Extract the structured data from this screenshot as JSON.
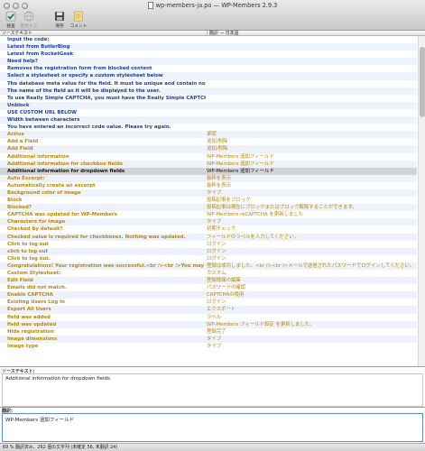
{
  "window": {
    "title": "wp-members-ja.po — WP-Members 2.9.3"
  },
  "toolbar": {
    "validate": "検査",
    "update": "更新する",
    "save": "保存",
    "comment": "コメント"
  },
  "columns": {
    "source": "ソーステキスト",
    "translation": "翻訳 — 日本語"
  },
  "rows": [
    {
      "src": "Input the code:",
      "dst": "",
      "state": "untranslated"
    },
    {
      "src": "Latest from ButlerBlog",
      "dst": "",
      "state": "untranslated"
    },
    {
      "src": "Latest from RocketGeek",
      "dst": "",
      "state": "untranslated"
    },
    {
      "src": "Need help?",
      "dst": "",
      "state": "untranslated"
    },
    {
      "src": "Removes the registration form from blocked content",
      "dst": "",
      "state": "untranslated"
    },
    {
      "src": "Select a stylesheet or specify a custom stylesheet below",
      "dst": "",
      "state": "untranslated"
    },
    {
      "src": "The database meta value for the field. It must be unique and contain no spaces (undersc...",
      "dst": "",
      "state": "untranslated"
    },
    {
      "src": "The name of the field as it will be displayed to the user.",
      "dst": "",
      "state": "untranslated"
    },
    {
      "src": "To use Really Simple CAPTCHA, you must have the Really Simple CAPTCHA plugin install...",
      "dst": "",
      "state": "untranslated"
    },
    {
      "src": "Unblock",
      "dst": "",
      "state": "untranslated"
    },
    {
      "src": "USE CUSTOM URL BELOW",
      "dst": "",
      "state": "untranslated"
    },
    {
      "src": "Width between characters",
      "dst": "",
      "state": "untranslated"
    },
    {
      "src": "You have entered an incorrect code value. Please try again.",
      "dst": "",
      "state": "untranslated"
    },
    {
      "src": "Active",
      "dst": "承認",
      "state": "fuzzy"
    },
    {
      "src": "Add a Field",
      "dst": "追加/削除",
      "state": "fuzzy"
    },
    {
      "src": "Add Field",
      "dst": "追加/削除",
      "state": "fuzzy"
    },
    {
      "src": "Additional information",
      "dst": "WP-Members 追加フィールド",
      "state": "fuzzy"
    },
    {
      "src": "Additional information for checkbox fields",
      "dst": "WP-Members 追加フィールド",
      "state": "fuzzy"
    },
    {
      "src": "Additional information for dropdown fields",
      "dst": "WP-Members 追加フィールド",
      "state": "selected"
    },
    {
      "src": "Auto Excerpt:",
      "dst": "抜粋を表示",
      "state": "fuzzy"
    },
    {
      "src": "Automatically create an excerpt",
      "dst": "抜粋を表示",
      "state": "fuzzy"
    },
    {
      "src": "Background color of image",
      "dst": "タイプ",
      "state": "fuzzy"
    },
    {
      "src": "Block",
      "dst": "投稿記事をブロック",
      "state": "fuzzy"
    },
    {
      "src": "Blocked?",
      "dst": "投稿記事は現在にブロックまたはブロック解除することができます。",
      "state": "fuzzy"
    },
    {
      "src": "CAPTCHA was updated for WP-Members",
      "dst": "WP-Members reCAPTCHA を更新しました",
      "state": "fuzzy"
    },
    {
      "src": "Characters for image",
      "dst": "タイプ",
      "state": "fuzzy"
    },
    {
      "src": "Checked by default?",
      "dst": "初期チェック",
      "state": "fuzzy"
    },
    {
      "src": "Checked value is required for checkboxes. Nothing was updated.",
      "dst": "フィールドのラベルを入力してください。",
      "state": "fuzzy"
    },
    {
      "src": "Click to log out",
      "dst": "ログイン",
      "state": "fuzzy"
    },
    {
      "src": "click to log out",
      "dst": "ログイン",
      "state": "fuzzy"
    },
    {
      "src": "Click to log out.",
      "dst": "ログイン",
      "state": "fuzzy"
    },
    {
      "src": "Congratulations! Your registration was successful.<br /><br />You may now log in usi...",
      "dst": "登録は成功しました。<br /><br />メールで送信されたパスワードでログインしてください。",
      "state": "fuzzy"
    },
    {
      "src": "Custom Stylesheet:",
      "dst": "カスタム",
      "state": "fuzzy"
    },
    {
      "src": "Edit Field",
      "dst": "登録情報の編集",
      "state": "fuzzy"
    },
    {
      "src": "Emails did not match.",
      "dst": "パスワードの確認",
      "state": "fuzzy"
    },
    {
      "src": "Enable CAPTCHA",
      "dst": "CAPTCHAの使用",
      "state": "fuzzy"
    },
    {
      "src": "Existing Users Log In",
      "dst": "ログイン",
      "state": "fuzzy"
    },
    {
      "src": "Export All Users",
      "dst": "エクスポート",
      "state": "fuzzy"
    },
    {
      "src": "field was added",
      "dst": "ラベル",
      "state": "fuzzy"
    },
    {
      "src": "field was updated",
      "dst": "WP-Members フィールド設定 を更新しました。",
      "state": "fuzzy"
    },
    {
      "src": "Hide registration",
      "dst": "登録完了",
      "state": "fuzzy"
    },
    {
      "src": "Image dimensions",
      "dst": "タイプ",
      "state": "fuzzy"
    },
    {
      "src": "Image type",
      "dst": "タイプ",
      "state": "fuzzy"
    }
  ],
  "source_panel": {
    "label": "ソーステキスト:",
    "text": "Additional information for dropdown fields"
  },
  "translation_panel": {
    "label": "翻訳:",
    "text": "WP-Members 追加フィールド"
  },
  "status": "69 % 翻訳済み、262 個の文字列 (未確定 56, 未翻訳 24)"
}
